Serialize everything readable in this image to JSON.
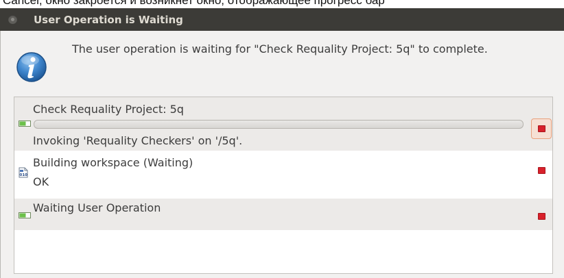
{
  "caption": {
    "text": "Cancel, окно закроется и возникнет окно, отображающее прогресс бар"
  },
  "window": {
    "title": "User Operation is Waiting"
  },
  "message": "The user operation is waiting for \"Check Requality Project: 5q\" to complete.",
  "colors": {
    "titlebar": "#3c3b37",
    "stop": "#d8212b",
    "info_icon": "#2f73b7"
  },
  "operations": [
    {
      "name": "Check Requality Project: 5q",
      "progress": 0,
      "detail": "Invoking 'Requality Checkers' on '/5q'.",
      "icon": "progress-job-icon"
    },
    {
      "name": "Building workspace (Waiting)",
      "detail": "OK",
      "icon": "build-binary-icon"
    },
    {
      "name": "Waiting User Operation",
      "icon": "progress-job-icon"
    }
  ]
}
